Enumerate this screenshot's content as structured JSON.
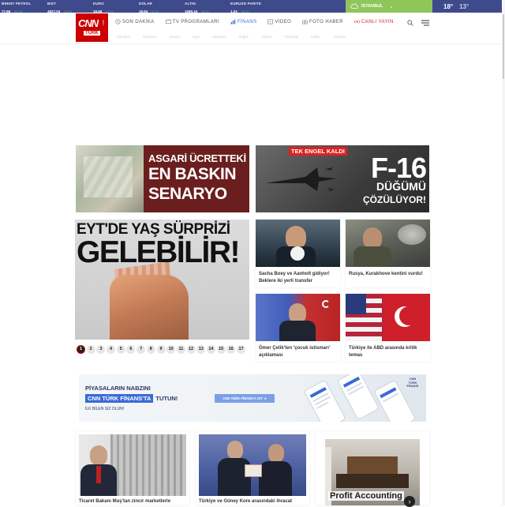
{
  "ticker": [
    {
      "name": "BRENT PETROL",
      "value": "77.66",
      "change": "%0.09",
      "dir": "up"
    },
    {
      "name": "BIST",
      "value": "4827.04",
      "change": "%0.32",
      "dir": "up"
    },
    {
      "name": "EURO",
      "value": "19.58",
      "change": "%0.16",
      "dir": "dn"
    },
    {
      "name": "DOLAR",
      "value": "18.84",
      "change": "%0.01",
      "dir": "up"
    },
    {
      "name": "ALTIN",
      "value": "1069.34",
      "change": "%0.22",
      "dir": "up"
    },
    {
      "name": "EURUSD PARITE",
      "value": "1.03",
      "change": "%0.04",
      "dir": "up"
    }
  ],
  "weather": {
    "city": "İSTANBUL",
    "high": "18°",
    "low": "13°"
  },
  "logo": {
    "main": "CNN",
    "sub": "TÜRK",
    "dot": ".com"
  },
  "nav": {
    "items": [
      {
        "label": "SON DAKİKA",
        "icon": "clock-icon"
      },
      {
        "label": "TV PROGRAMLARI",
        "icon": "tv-icon"
      },
      {
        "label": "FİNANS",
        "icon": "chart-icon"
      },
      {
        "label": "VİDEO",
        "icon": "video-icon"
      },
      {
        "label": "FOTO HABER",
        "icon": "camera-icon"
      },
      {
        "label": "CANLI YAYIN",
        "icon": "live-icon"
      }
    ]
  },
  "subnav": [
    "Gündem",
    "Ekonomi",
    "Dünya",
    "Spor",
    "Magazin",
    "Sağlık",
    "Yaşam",
    "Teknoloji",
    "Kültür",
    "Yazarlar"
  ],
  "banners": {
    "left": {
      "line1": "ASGARİ ÜCRETTEKİ",
      "line2": "EN BASKIN",
      "line3": "SENARYO"
    },
    "right": {
      "tag": "TEK ENGEL KALDI",
      "line1": "F-16",
      "line2": "DÜĞÜMÜ",
      "line3": "ÇÖZÜLÜYOR!"
    }
  },
  "hero": {
    "line1": "EYT'DE YAŞ SÜRPRİZİ",
    "line2": "GELEBİLİR!"
  },
  "pager": {
    "pages": [
      "1",
      "2",
      "3",
      "4",
      "5",
      "6",
      "7",
      "8",
      "9",
      "10",
      "11",
      "12",
      "13",
      "14",
      "15",
      "16",
      "17"
    ],
    "active": "1"
  },
  "news": [
    {
      "caption": "Sacha Boey ve Aanholt gidiyor! Beklere iki yerli transfer"
    },
    {
      "caption": "Rusya, Kurakhove kentini vurdu!"
    },
    {
      "caption": "Ömer Çelik'ten 'çocuk istismarı' açıklaması"
    },
    {
      "caption": "Türkiye ile ABD arasında kritik temas"
    }
  ],
  "finance_banner": {
    "line1": "PİYASALARIN NABZINI",
    "highlight": "CNN TÜRK FİNANS'TA",
    "line2_rest": "TUTUN!",
    "line3": "İLK BİLEN SİZ OLUN!",
    "cta": "CNN TÜRK FİNANS'A GİT",
    "badge": "CNN TÜRK FİNANS"
  },
  "bottom_cards": [
    {
      "caption": "Ticaret Bakanı Muş'tan zincir marketlerle"
    },
    {
      "caption": "Türkiye ve Güney Kore arasındaki ihracat"
    },
    {
      "caption": "Profit Accounting"
    }
  ],
  "colors": {
    "brand_red": "#cc0000",
    "ticker_bg": "#3e4a8c",
    "weather_bg": "#8fc65a",
    "finance_blue": "#3a6ad6"
  }
}
